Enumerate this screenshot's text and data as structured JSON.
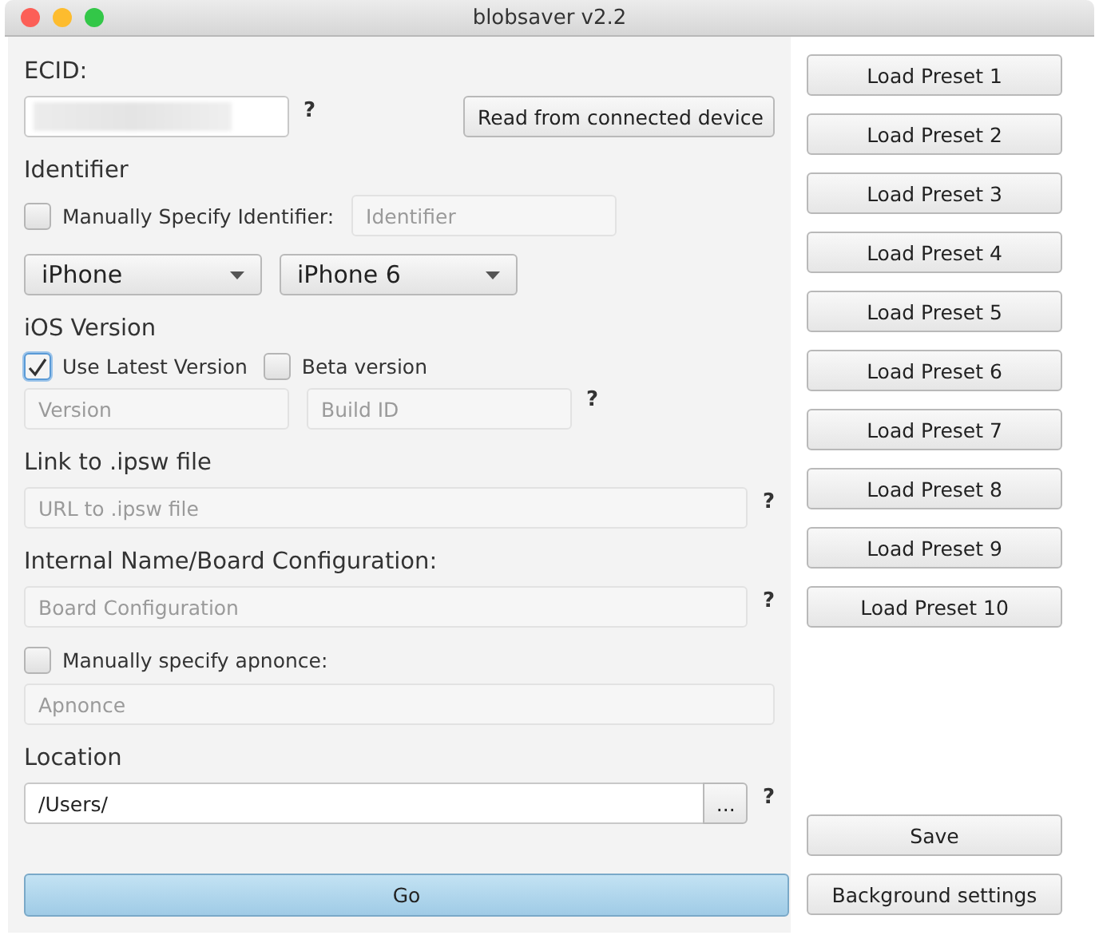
{
  "window": {
    "title": "blobsaver v2.2"
  },
  "ecid": {
    "label": "ECID:",
    "value_blurred": true,
    "help": "?"
  },
  "read_button": "Read from connected device",
  "identifier": {
    "label": "Identifier",
    "manual": {
      "label": "Manually Specify Identifier:",
      "checked": false
    },
    "field": {
      "placeholder": "Identifier",
      "disabled": true
    }
  },
  "device": {
    "type": "iPhone",
    "model": "iPhone 6"
  },
  "ios_version": {
    "label": "iOS Version",
    "options": [
      {
        "label": "Use Latest Version",
        "checked": true
      },
      {
        "label": "Beta version",
        "checked": false
      }
    ],
    "fields": [
      {
        "placeholder": "Version",
        "disabled": true
      },
      {
        "placeholder": "Build ID",
        "disabled": true
      }
    ],
    "help": "?"
  },
  "ipsw": {
    "label": "Link to .ipsw file",
    "field": {
      "placeholder": "URL to .ipsw file",
      "disabled": true
    },
    "help": "?"
  },
  "board": {
    "label": "Internal Name/Board Configuration:",
    "field": {
      "placeholder": "Board Configuration",
      "disabled": true
    },
    "help": "?"
  },
  "apnonce": {
    "label": "Manually specify apnonce:",
    "checked": false,
    "field": {
      "placeholder": "Apnonce",
      "disabled": true
    }
  },
  "location": {
    "label": "Location",
    "value": "/Users/",
    "browse": "...",
    "help": "?"
  },
  "go_button": "Go",
  "presets": [
    "Load Preset 1",
    "Load Preset 2",
    "Load Preset 3",
    "Load Preset 4",
    "Load Preset 5",
    "Load Preset 6",
    "Load Preset 7",
    "Load Preset 8",
    "Load Preset 9",
    "Load Preset 10"
  ],
  "save_button": "Save",
  "background_button": "Background settings"
}
